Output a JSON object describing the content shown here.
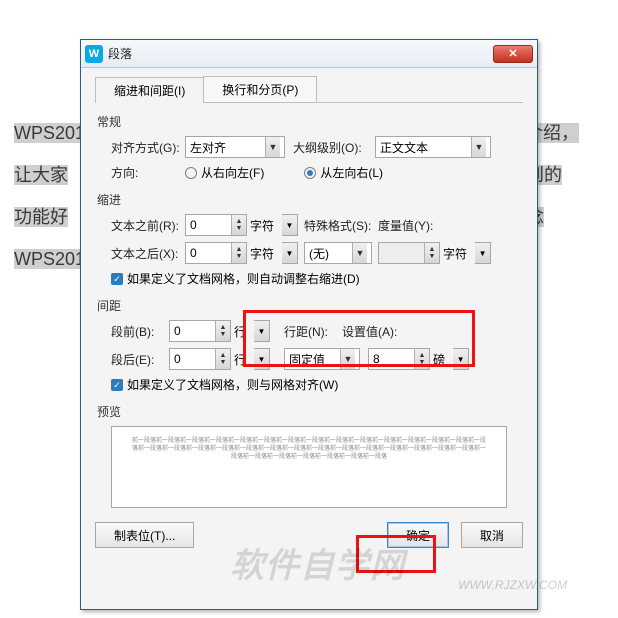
{
  "background": {
    "line1a": "WPS201",
    "line1b": "介绍，",
    "line2a": "让大家",
    "line2b": "用到的",
    "line3a": "功能好",
    "line3b": "念",
    "line4a": "WPS201"
  },
  "dialog": {
    "icon_letter": "W",
    "title": "段落",
    "tabs": {
      "indent": "缩进和间距(I)",
      "page": "换行和分页(P)"
    },
    "section_general": "常规",
    "align_label": "对齐方式(G):",
    "align_value": "左对齐",
    "outline_label": "大纲级别(O):",
    "outline_value": "正文文本",
    "direction_label": "方向:",
    "dir_rtl": "从右向左(F)",
    "dir_ltr": "从左向右(L)",
    "section_indent": "缩进",
    "before_text_label": "文本之前(R):",
    "before_text_value": "0",
    "after_text_label": "文本之后(X):",
    "after_text_value": "0",
    "char_unit": "字符",
    "special_label": "特殊格式(S):",
    "special_value": "(无)",
    "measure_label": "度量值(Y):",
    "measure_value": "",
    "auto_indent_cb": "如果定义了文档网格，则自动调整右缩进(D)",
    "section_spacing": "间距",
    "space_before_label": "段前(B):",
    "space_before_value": "0",
    "space_after_label": "段后(E):",
    "space_after_value": "0",
    "line_unit": "行",
    "line_spacing_label": "行距(N):",
    "line_spacing_value": "固定值",
    "set_value_label": "设置值(A):",
    "set_value_value": "8",
    "point_unit": "磅",
    "snap_grid_cb": "如果定义了文档网格，则与网格对齐(W)",
    "preview_label": "预览",
    "preview_text": "前一段落前一段落前一段落前一段落前一段落前一段落前一段落前一段落前一段落前一段落前一段落前一段落前一段落前一段落前一段落前一段落前一段落前一段落前一段落前一段落前一段落前一段落前一段落前一段落前一段落前一段落前一段落前一段落前一段落前一段落前一段落前一段落前一段落前一段落前一段落前一段落",
    "tabstops_btn": "制表位(T)...",
    "ok_btn": "确定",
    "cancel_btn": "取消"
  },
  "watermark": {
    "text": "软件自学网",
    "url": "WWW.RJZXW.COM"
  }
}
